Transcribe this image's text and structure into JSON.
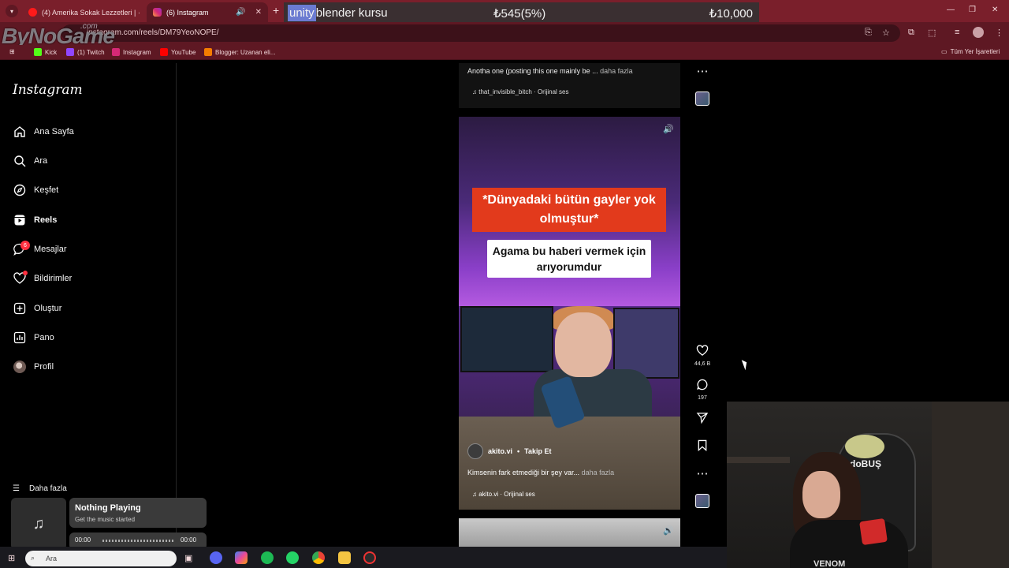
{
  "browser": {
    "tabs": [
      {
        "title": "(4) Amerika Sokak Lezzetleri | ·",
        "active": false
      },
      {
        "title": "(6) Instagram",
        "active": true
      }
    ],
    "url": "instagram.com/reels/DM79YeoNOPE/",
    "bookmarks": [
      "Kick",
      "(1) Twitch",
      "Instagram",
      "YouTube",
      "Blogger: Uzanan eli..."
    ],
    "all_bookmarks": "Tüm Yer İşaretleri"
  },
  "overlay": {
    "highlight": "unity",
    "text": " blender kursu",
    "progress": "₺545(5%)",
    "goal": "₺10,000",
    "progress_fraction": 0.05
  },
  "watermark": {
    "logo": "ByNoGame",
    "sub": ".com"
  },
  "sidebar": {
    "logo": "Instagram",
    "items": [
      {
        "label": "Ana Sayfa",
        "icon": "home-icon"
      },
      {
        "label": "Ara",
        "icon": "search-icon"
      },
      {
        "label": "Keşfet",
        "icon": "compass-icon"
      },
      {
        "label": "Reels",
        "icon": "reels-icon"
      },
      {
        "label": "Mesajlar",
        "icon": "messenger-icon"
      },
      {
        "label": "Bildirimler",
        "icon": "heart-icon"
      },
      {
        "label": "Oluştur",
        "icon": "plus-icon"
      },
      {
        "label": "Pano",
        "icon": "dashboard-icon"
      },
      {
        "label": "Profil",
        "icon": "avatar"
      }
    ],
    "messages_badge": "6",
    "more": "Daha fazla"
  },
  "prev_reel": {
    "caption": "Anotha one (posting this one mainly be ...",
    "more": "daha fazla",
    "audio": "that_invisible_bitch · Orijinal ses"
  },
  "reel": {
    "subtitle_red": "*Dünyadaki bütün gayler yok olmuştur*",
    "subtitle_white": "Agama bu haberi vermek için arıyorumdur",
    "author": "akito.vi",
    "follow": "Takip Et",
    "caption": "Kimsenin fark etmediği bir şey var...",
    "more": "daha fazla",
    "audio": "akito.vi · Orijinal ses",
    "likes": "44,6 B",
    "comments": "197"
  },
  "webcam": {
    "chair_text": "doBUŞ",
    "shirt_text": "VENOM"
  },
  "music": {
    "title": "Nothing Playing",
    "subtitle": "Get the music started",
    "time_start": "00:00",
    "time_end": "00:00"
  },
  "taskbar": {
    "search_placeholder": "Ara"
  }
}
